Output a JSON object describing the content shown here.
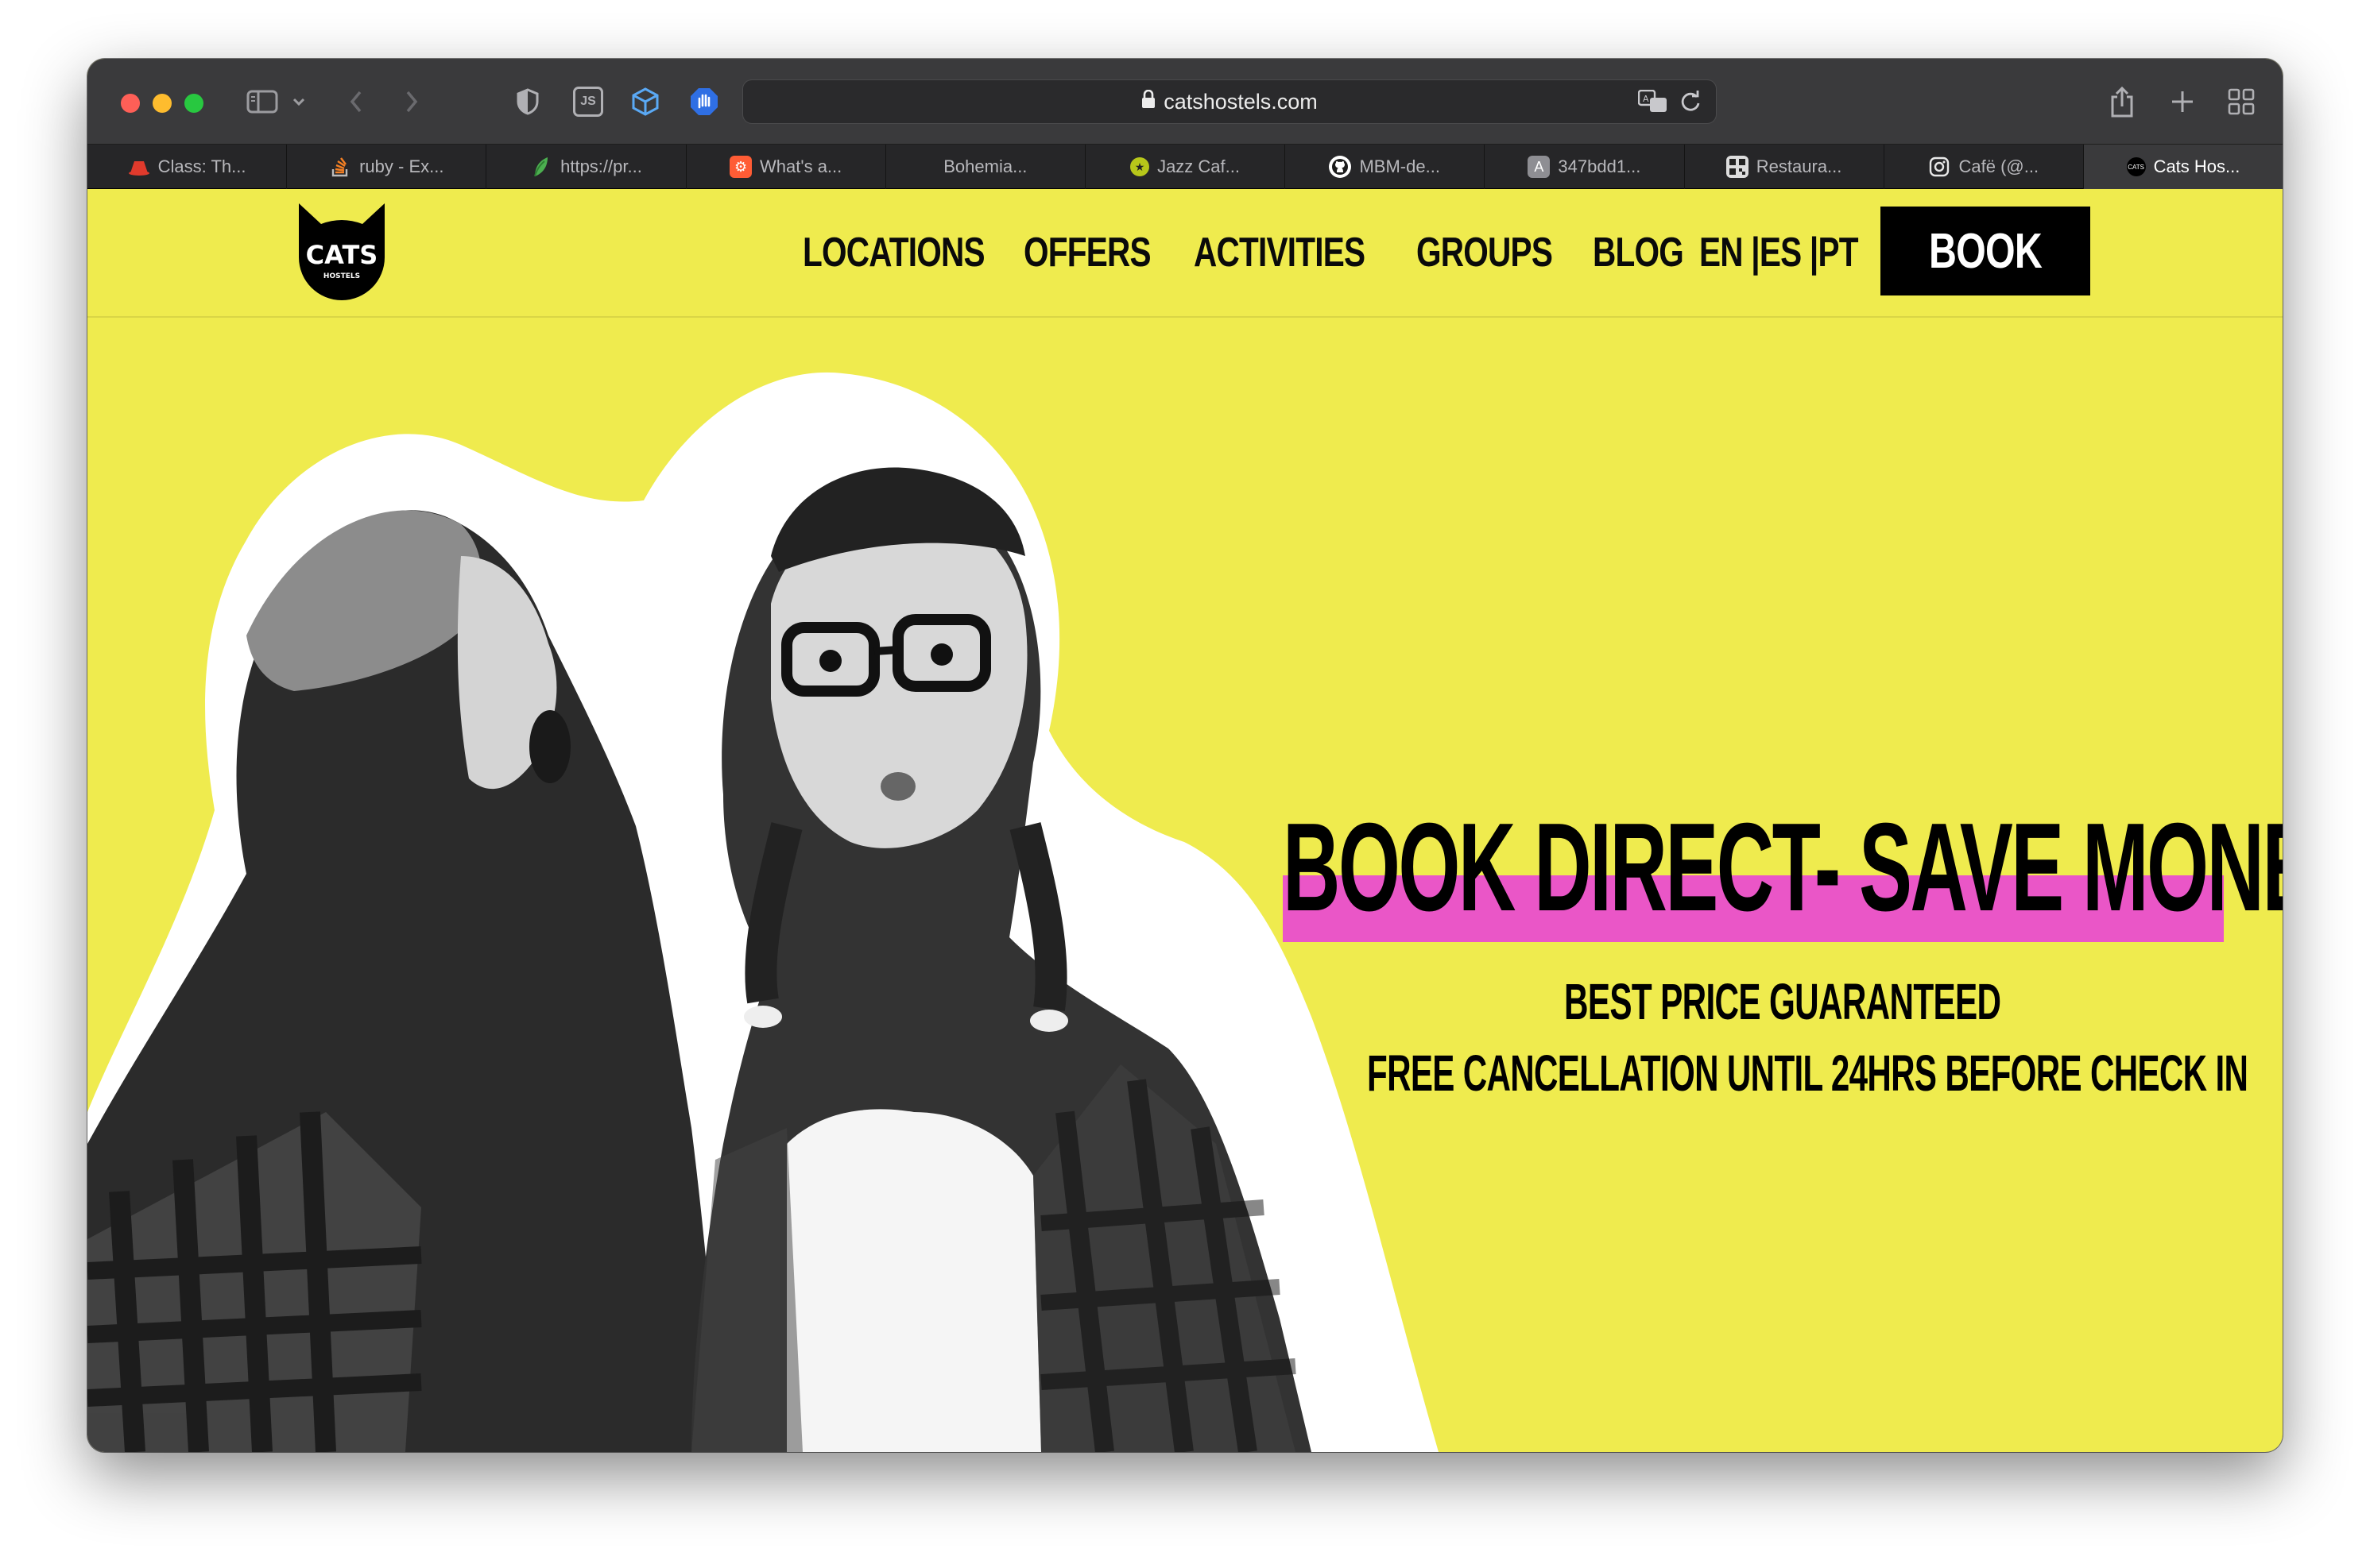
{
  "browser": {
    "url": "catshostels.com",
    "tabs": [
      {
        "label": "Class: Th...",
        "icon": "red-hat-icon",
        "color": "#e03a2c"
      },
      {
        "label": "ruby - Ex...",
        "icon": "stack-overflow-icon",
        "color": "#f48024"
      },
      {
        "label": "https://pr...",
        "icon": "leaf-icon",
        "color": "#4caf50"
      },
      {
        "label": "What's a...",
        "icon": "hubspot-icon",
        "color": "#ff5c35"
      },
      {
        "label": "Bohemia...",
        "icon": "",
        "color": ""
      },
      {
        "label": "Jazz Caf...",
        "icon": "star-badge-icon",
        "color": "#b7c71a"
      },
      {
        "label": "MBM-de...",
        "icon": "github-icon",
        "color": "#ffffff"
      },
      {
        "label": "347bdd1...",
        "icon": "letter-a-icon",
        "color": "#8e8e93"
      },
      {
        "label": "Restaura...",
        "icon": "qr-icon",
        "color": "#dddddd"
      },
      {
        "label": "Cafë (@...",
        "icon": "instagram-icon",
        "color": "#ffffff"
      },
      {
        "label": "Cats Hos...",
        "icon": "cats-hostel-icon",
        "color": "#000000"
      }
    ],
    "toolbar_icons": {
      "js": "JS"
    }
  },
  "site": {
    "logo_text": "CATS",
    "logo_subtext": "HOSTELS",
    "nav": [
      {
        "label": "LOCATIONS"
      },
      {
        "label": "OFFERS"
      },
      {
        "label": "ACTIVITIES"
      },
      {
        "label": "GROUPS"
      },
      {
        "label": "BLOG"
      }
    ],
    "languages": "EN |ES |PT",
    "book_label": "BOOK",
    "hero": {
      "headline": "BOOK DIRECT- SAVE MONEY",
      "subline1": "BEST PRICE GUARANTEED",
      "subline2": "FREE CANCELLATION UNTIL 24HRS BEFORE CHECK IN"
    }
  },
  "colors": {
    "brand_yellow": "#efeb4e",
    "highlight_pink": "#ea56c7",
    "black": "#000000"
  }
}
